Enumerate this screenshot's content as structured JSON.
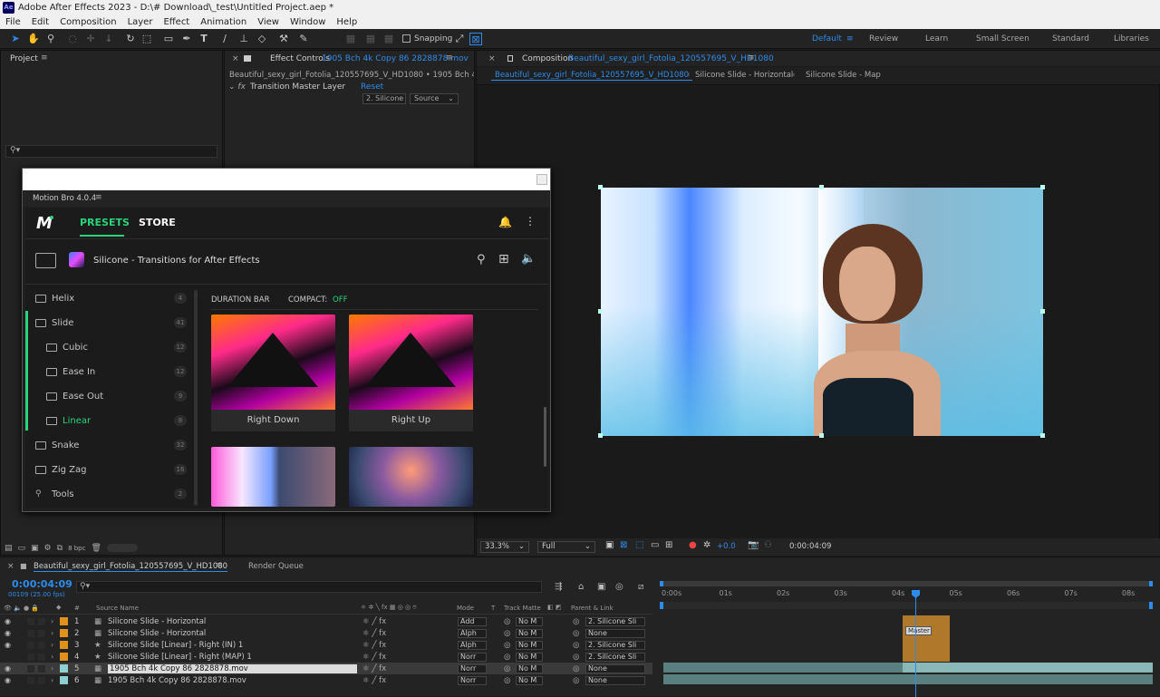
{
  "window": {
    "app_icon": "Ae",
    "title": "Adobe After Effects 2023 - D:\\# Download\\_test\\Untitled Project.aep *"
  },
  "menu": [
    "File",
    "Edit",
    "Composition",
    "Layer",
    "Effect",
    "Animation",
    "View",
    "Window",
    "Help"
  ],
  "toolbar": {
    "snapping": "Snapping",
    "workspaces": [
      "Default",
      "Review",
      "Learn",
      "Small Screen",
      "Standard",
      "Libraries"
    ]
  },
  "project": {
    "title": "Project",
    "search_placeholder": "",
    "bpc": "8 bpc"
  },
  "effect_controls": {
    "tab": "Effect Controls",
    "layer": "1905 Bch 4k Copy 86 2828878.mov",
    "path": "Beautiful_sexy_girl_Fotolia_120557695_V_HD1080 • 1905 Bch 4k Copy",
    "fx_name": "Transition Master Layer",
    "reset": "Reset",
    "dropdown1": "2. Silicone",
    "dropdown2": "Source"
  },
  "motion_bro": {
    "title": "Motion Bro 4.0.4",
    "tab_presets": "PRESETS",
    "tab_store": "STORE",
    "pack": "Silicone - Transitions for After Effects",
    "duration_bar": "DURATION BAR",
    "compact_label": "COMPACT:",
    "compact_value": "OFF",
    "categories": [
      {
        "label": "Helix",
        "count": "4",
        "indent": false,
        "active": false
      },
      {
        "label": "Slide",
        "count": "41",
        "indent": false,
        "active": false
      },
      {
        "label": "Cubic",
        "count": "12",
        "indent": true,
        "active": false
      },
      {
        "label": "Ease In",
        "count": "12",
        "indent": true,
        "active": false
      },
      {
        "label": "Ease Out",
        "count": "9",
        "indent": true,
        "active": false
      },
      {
        "label": "Linear",
        "count": "8",
        "indent": true,
        "active": true
      },
      {
        "label": "Snake",
        "count": "32",
        "indent": false,
        "active": false
      },
      {
        "label": "Zig Zag",
        "count": "16",
        "indent": false,
        "active": false
      },
      {
        "label": "Tools",
        "count": "2",
        "indent": false,
        "active": false
      }
    ],
    "presets": [
      "Right Down",
      "Right Up"
    ]
  },
  "composition": {
    "tab": "Composition",
    "name": "Beautiful_sexy_girl_Fotolia_120557695_V_HD1080",
    "breadcrumbs": [
      "Beautiful_sexy_girl_Fotolia_120557695_V_HD1080",
      "Silicone Slide - Horizontal",
      "Silicone Slide - Map"
    ],
    "zoom": "33.3%",
    "resolution": "Full",
    "exposure": "+0.0",
    "timecode": "0:00:04:09"
  },
  "timeline": {
    "tab": "Beautiful_sexy_girl_Fotolia_120557695_V_HD1080",
    "render_queue": "Render Queue",
    "timecode": "0:00:04:09",
    "frames": "00109 (25.00 fps)",
    "columns": {
      "source": "Source Name",
      "mode": "Mode",
      "t": "T",
      "matte": "Track Matte",
      "parent": "Parent & Link"
    },
    "ruler": [
      "0:00s",
      "01s",
      "02s",
      "03s",
      "04s",
      "05s",
      "06s",
      "07s",
      "08s"
    ],
    "marker": "Master",
    "layers": [
      {
        "num": "1",
        "name": "Silicone Slide - Horizontal",
        "mode": "Add",
        "matte": "No M",
        "parent": "2. Silicone Sli",
        "color": "#e0901c"
      },
      {
        "num": "2",
        "name": "Silicone Slide - Horizontal",
        "mode": "Alph",
        "matte": "No M",
        "parent": "None",
        "color": "#e0901c"
      },
      {
        "num": "3",
        "name": "Silicone Slide [Linear] - Right (IN) 1",
        "mode": "Alph",
        "matte": "No M",
        "parent": "2. Silicone Sli",
        "color": "#e0901c"
      },
      {
        "num": "4",
        "name": "Silicone Slide [Linear] - Right (MAP) 1",
        "mode": "Norr",
        "matte": "No M",
        "parent": "2. Silicone Sli",
        "color": "#e0901c"
      },
      {
        "num": "5",
        "name": "1905 Bch 4k Copy 86 2828878.mov",
        "mode": "Norr",
        "matte": "No M",
        "parent": "None",
        "color": "#8ecfcf"
      },
      {
        "num": "6",
        "name": "1905 Bch 4k Copy 86 2828878.mov",
        "mode": "Norr",
        "matte": "No M",
        "parent": "None",
        "color": "#8ecfcf"
      }
    ]
  }
}
